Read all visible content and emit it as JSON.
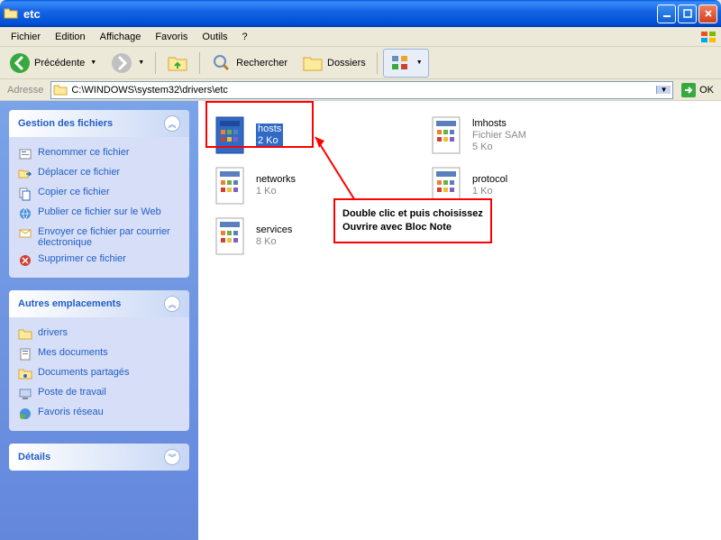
{
  "title": "etc",
  "menubar": [
    "Fichier",
    "Edition",
    "Affichage",
    "Favoris",
    "Outils",
    "?"
  ],
  "toolbar": {
    "back": "Précédente",
    "search": "Rechercher",
    "folders": "Dossiers"
  },
  "address": {
    "label": "Adresse",
    "value": "C:\\WINDOWS\\system32\\drivers\\etc",
    "go": "OK"
  },
  "sidebar": {
    "panels": [
      {
        "title": "Gestion des fichiers",
        "expanded": true,
        "tasks": [
          {
            "icon": "rename",
            "label": "Renommer ce fichier"
          },
          {
            "icon": "move",
            "label": "Déplacer ce fichier"
          },
          {
            "icon": "copy",
            "label": "Copier ce fichier"
          },
          {
            "icon": "publish",
            "label": "Publier ce fichier sur le Web"
          },
          {
            "icon": "mail",
            "label": "Envoyer ce fichier par courrier électronique"
          },
          {
            "icon": "delete",
            "label": "Supprimer ce fichier"
          }
        ]
      },
      {
        "title": "Autres emplacements",
        "expanded": true,
        "tasks": [
          {
            "icon": "folder",
            "label": "drivers"
          },
          {
            "icon": "mydocs",
            "label": "Mes documents"
          },
          {
            "icon": "shared",
            "label": "Documents partagés"
          },
          {
            "icon": "computer",
            "label": "Poste de travail"
          },
          {
            "icon": "network",
            "label": "Favoris réseau"
          }
        ]
      },
      {
        "title": "Détails",
        "expanded": false,
        "tasks": []
      }
    ]
  },
  "files": [
    {
      "name": "hosts",
      "meta1": "2 Ko",
      "meta2": "",
      "selected": true
    },
    {
      "name": "lmhosts",
      "meta1": "Fichier SAM",
      "meta2": "5 Ko",
      "selected": false
    },
    {
      "name": "networks",
      "meta1": "1 Ko",
      "meta2": "",
      "selected": false
    },
    {
      "name": "protocol",
      "meta1": "1 Ko",
      "meta2": "",
      "selected": false
    },
    {
      "name": "services",
      "meta1": "8 Ko",
      "meta2": "",
      "selected": false
    }
  ],
  "annotation": {
    "line1": "Double clic et puis choisissez",
    "line2": "Ouvrire avec Bloc Note"
  }
}
